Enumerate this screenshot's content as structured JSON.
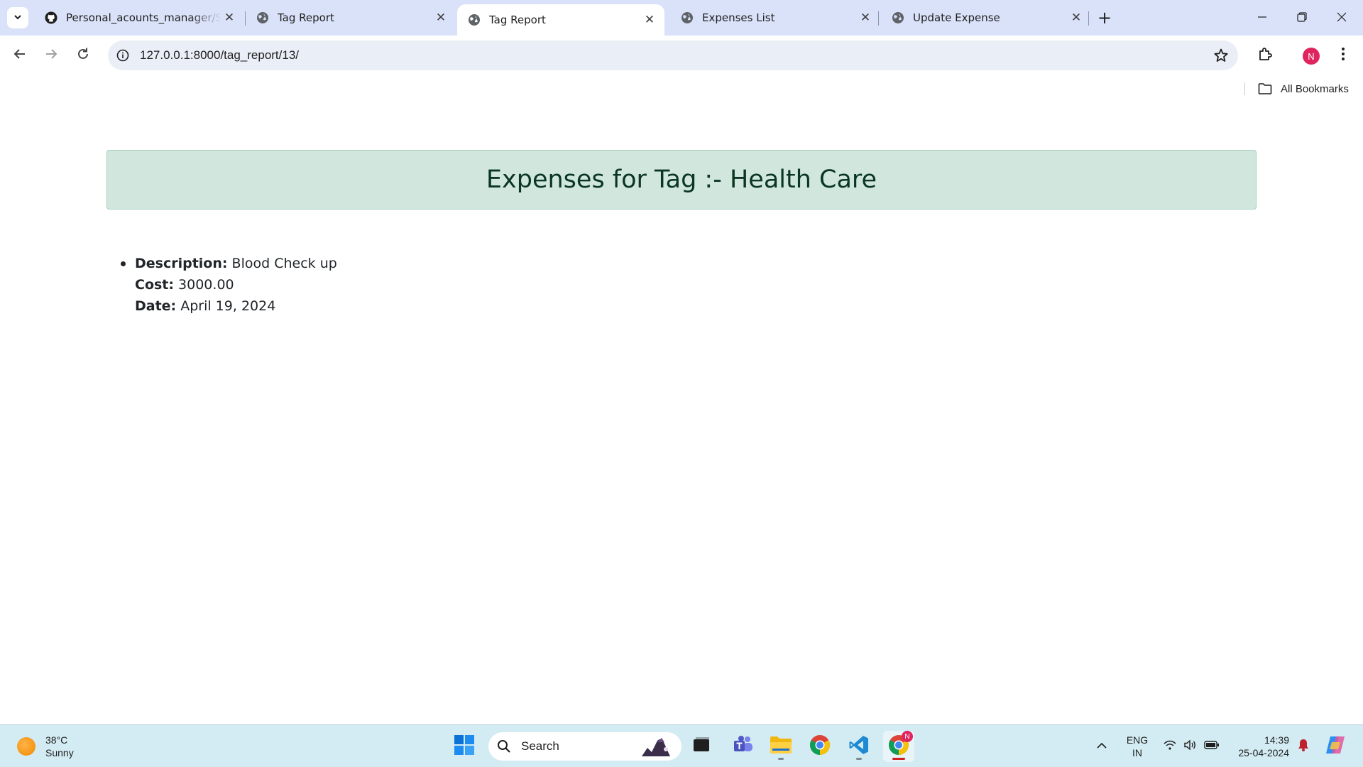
{
  "browser": {
    "tabs": [
      {
        "title": "Personal_acounts_manager/Sc",
        "icon": "github-icon",
        "active": false
      },
      {
        "title": "Tag Report",
        "icon": "globe-icon",
        "active": false
      },
      {
        "title": "Tag Report",
        "icon": "globe-icon",
        "active": true
      },
      {
        "title": "Expenses List",
        "icon": "globe-icon",
        "active": false
      },
      {
        "title": "Update Expense",
        "icon": "globe-icon",
        "active": false
      }
    ],
    "close_glyph": "✕",
    "new_tab_glyph": "+",
    "url": "127.0.0.1:8000/tag_report/13/",
    "profile_initial": "N",
    "bookmarks": {
      "all_label": "All Bookmarks"
    }
  },
  "page": {
    "heading": "Expenses for Tag :- Health Care",
    "expenses": [
      {
        "description_label": "Description:",
        "description": "Blood Check up",
        "cost_label": "Cost:",
        "cost": "3000.00",
        "date_label": "Date:",
        "date": "April 19, 2024"
      }
    ]
  },
  "taskbar": {
    "weather": {
      "temperature": "38°C",
      "condition": "Sunny"
    },
    "search_placeholder": "Search",
    "language": {
      "line1": "ENG",
      "line2": "IN"
    },
    "clock": {
      "time": "14:39",
      "date": "25-04-2024"
    },
    "chrome_badge": "N"
  },
  "colors": {
    "tab_strip": "#dae2f9",
    "alert_bg": "#d1e7dd",
    "alert_text": "#0a3622",
    "taskbar": "#d3ecf3",
    "profile": "#e0245e"
  }
}
